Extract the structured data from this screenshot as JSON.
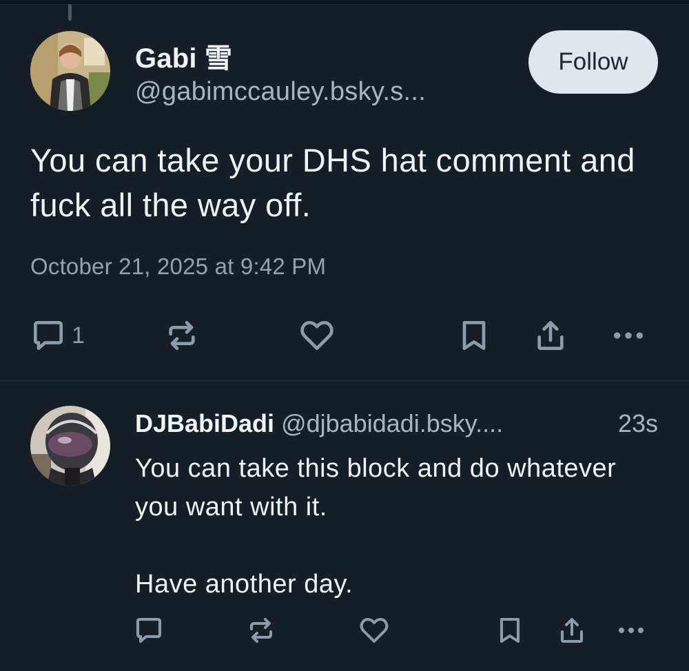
{
  "post1": {
    "author_name": "Gabi 雪",
    "author_handle": "@gabimccauley.bsky.s...",
    "follow_label": "Follow",
    "text": "You can take your DHS hat comment and fuck all the way off.",
    "timestamp": "October 21, 2025 at 9:42 PM",
    "reply_count": "1"
  },
  "post2": {
    "author_name": "DJBabiDadi",
    "author_handle": "@djbabidadi.bsky....",
    "time_ago": "23s",
    "text_line1": "You can take this block and do whatever you want with it.",
    "text_line2": "Have another day."
  },
  "colors": {
    "background": "#161e27",
    "text_primary": "#f1f3f5",
    "text_secondary": "#a8b6c3",
    "icon": "#8c9cab",
    "follow_button_bg": "#dfe6ec"
  },
  "icons": [
    "reply-icon",
    "repost-icon",
    "like-icon",
    "bookmark-icon",
    "share-icon",
    "more-icon"
  ]
}
